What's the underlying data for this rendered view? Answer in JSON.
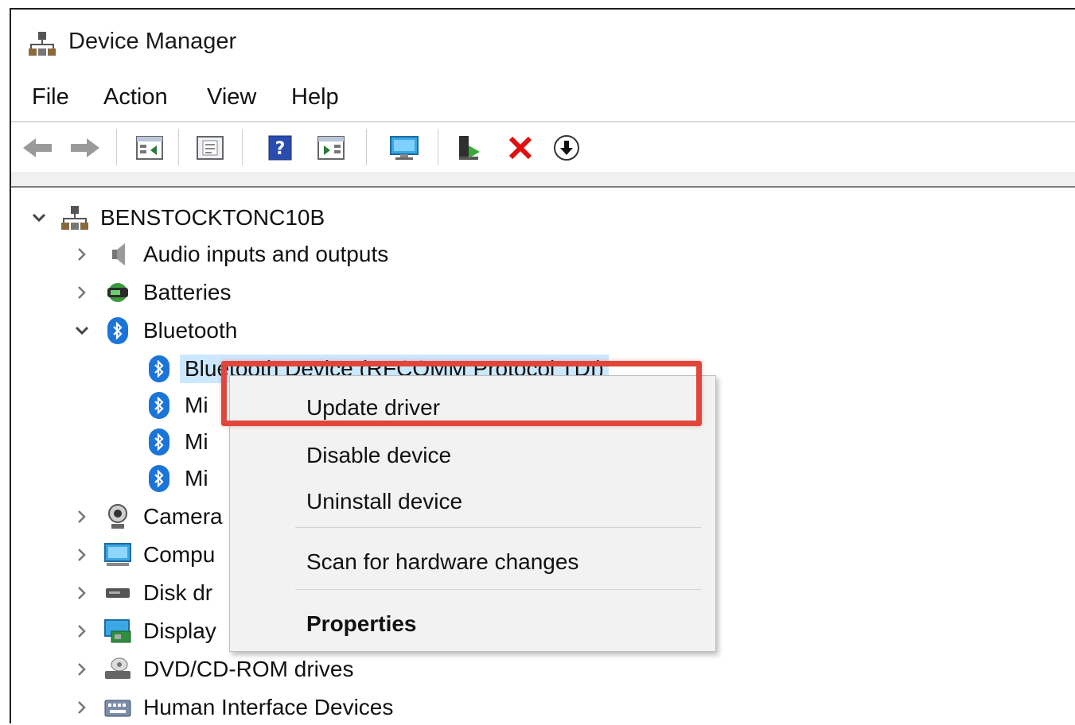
{
  "window": {
    "title": "Device Manager"
  },
  "menu": {
    "items": [
      "File",
      "Action",
      "View",
      "Help"
    ]
  },
  "toolbar": {
    "buttons": [
      "back-icon",
      "forward-icon",
      "show-hide-console-tree-icon",
      "properties-icon",
      "help-icon",
      "action-pane-icon",
      "scan-hardware-icon",
      "update-driver-icon",
      "uninstall-icon",
      "download-icon"
    ]
  },
  "tree": {
    "root": "BENSTOCKTONC10B",
    "categories": {
      "audio": "Audio inputs and outputs",
      "batteries": "Batteries",
      "bluetooth": "Bluetooth",
      "cameras": "Camera",
      "computer": "Compu",
      "disk": "Disk dr",
      "display": "Display",
      "dvd": "DVD/CD-ROM drives",
      "hid": "Human Interface Devices"
    },
    "bluetooth_children": [
      "Bluetooth Device (RFCOMM Protocol TDI)",
      "Mi",
      "Mi",
      "Mi"
    ]
  },
  "context_menu": {
    "update_driver": "Update driver",
    "disable_device": "Disable device",
    "uninstall_device": "Uninstall device",
    "scan_hardware": "Scan for hardware changes",
    "properties": "Properties"
  },
  "colors": {
    "highlight": "#e0463a",
    "selection": "#cce8ff",
    "bluetooth": "#1b74d8"
  }
}
